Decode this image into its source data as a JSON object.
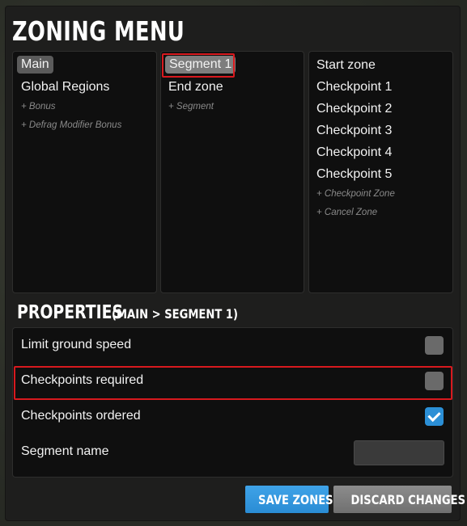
{
  "window": {
    "title": "ZONING MENU"
  },
  "tracks": {
    "items": [
      {
        "label": "Main",
        "selected": true
      },
      {
        "label": "Global Regions"
      }
    ],
    "add_actions": [
      "+ Bonus",
      "+ Defrag Modifier Bonus"
    ]
  },
  "segments": {
    "items": [
      {
        "label": "Segment 1",
        "selected": true
      },
      {
        "label": "End zone"
      }
    ],
    "add_actions": [
      "+ Segment"
    ]
  },
  "zones": {
    "items": [
      {
        "label": "Start zone"
      },
      {
        "label": "Checkpoint 1"
      },
      {
        "label": "Checkpoint 2"
      },
      {
        "label": "Checkpoint 3"
      },
      {
        "label": "Checkpoint 4"
      },
      {
        "label": "Checkpoint 5"
      }
    ],
    "add_actions": [
      "+ Checkpoint Zone",
      "+ Cancel Zone"
    ]
  },
  "properties": {
    "title": "PROPERTIES",
    "context": "(MAIN > SEGMENT 1)",
    "rows": [
      {
        "label": "Limit ground speed",
        "type": "checkbox",
        "checked": false
      },
      {
        "label": "Checkpoints required",
        "type": "checkbox",
        "checked": false
      },
      {
        "label": "Checkpoints ordered",
        "type": "checkbox",
        "checked": true
      },
      {
        "label": "Segment name",
        "type": "text",
        "value": ""
      }
    ]
  },
  "buttons": {
    "save": "SAVE ZONES",
    "discard": "DISCARD CHANGES"
  },
  "colors": {
    "accent": "#2b8fd6",
    "highlight": "#d8191e",
    "panel": "#1e1e1d"
  }
}
